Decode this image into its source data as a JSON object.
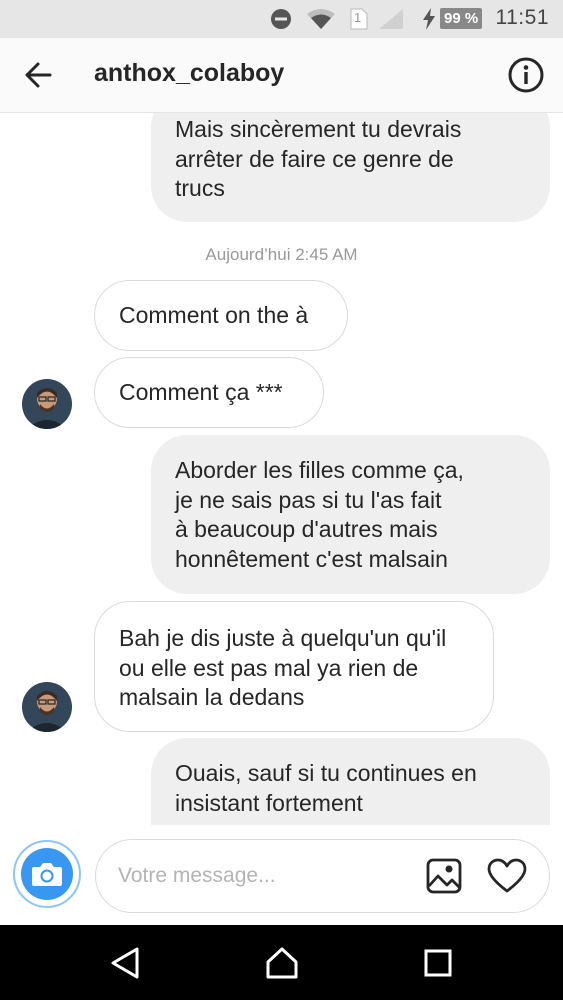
{
  "status_bar": {
    "battery": "99 %",
    "sim": "1",
    "time": "11:51"
  },
  "header": {
    "back_icon": "arrow-left-icon",
    "username": "anthox_colaboy",
    "info_icon": "info-circle-icon"
  },
  "conversation": {
    "timestamp": "Aujourd’hui 2:45 AM",
    "messages": [
      {
        "direction": "outgoing",
        "lines": [
          "Mais sincèrement tu devrais",
          "arrêter de faire ce genre de",
          "trucs"
        ]
      },
      {
        "direction": "incoming",
        "lines": [
          "Comment on the à"
        ]
      },
      {
        "direction": "incoming",
        "lines": [
          "Comment ça ***"
        ]
      },
      {
        "direction": "outgoing",
        "lines": [
          "Aborder les filles comme ça,",
          "je ne sais pas si tu l'as fait",
          "à beaucoup d'autres mais",
          "honnêtement c'est malsain"
        ]
      },
      {
        "direction": "incoming",
        "lines": [
          "Bah je dis juste à quelqu'un qu'il",
          "ou elle est pas mal ya rien de",
          "malsain la dedans"
        ]
      },
      {
        "direction": "outgoing",
        "lines": [
          "Ouais, sauf si tu continues en",
          "insistant fortement"
        ]
      }
    ]
  },
  "composer": {
    "placeholder": "Votre message...",
    "camera_icon": "camera-icon",
    "gallery_icon": "image-gallery-icon",
    "like_icon": "heart-icon"
  },
  "colors": {
    "accent": "#3897f0",
    "outgoing_bubble": "#efefef",
    "incoming_border": "#dbdbdb"
  }
}
